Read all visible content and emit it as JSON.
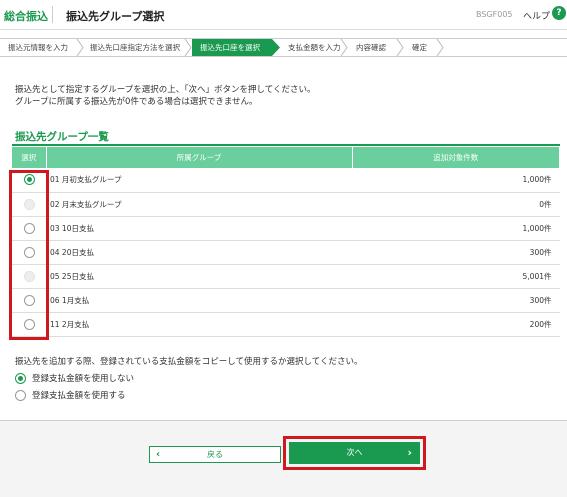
{
  "header": {
    "brand": "総合振込",
    "title": "振込先グループ選択",
    "screen_id": "BSGF005",
    "help_label": "ヘルプ",
    "help_icon": "?"
  },
  "steps": [
    {
      "label": "振込元情報を入力",
      "active": false
    },
    {
      "label": "振込先口座指定方法を選択",
      "active": false
    },
    {
      "label": "振込先口座を選択",
      "active": true
    },
    {
      "label": "支払金額を入力",
      "active": false
    },
    {
      "label": "内容確認",
      "active": false
    },
    {
      "label": "確定",
      "active": false
    }
  ],
  "intro": {
    "line1": "振込先として指定するグループを選択の上、「次へ」ボタンを押してください。",
    "line2": "グループに所属する振込先が0件である場合は選択できません。"
  },
  "section": {
    "title": "振込先グループ一覧"
  },
  "table": {
    "headers": {
      "select": "選択",
      "group": "所属グループ",
      "count": "追加対象件数"
    },
    "rows": [
      {
        "group": "01 月初支払グループ",
        "count": "1,000件",
        "state": "checked"
      },
      {
        "group": "02 月末支払グループ",
        "count": "0件",
        "state": "disabled"
      },
      {
        "group": "03 10日支払",
        "count": "1,000件",
        "state": "unchecked"
      },
      {
        "group": "04 20日支払",
        "count": "300件",
        "state": "unchecked"
      },
      {
        "group": "05 25日支払",
        "count": "5,001件",
        "state": "disabled"
      },
      {
        "group": "06 1月支払",
        "count": "300件",
        "state": "unchecked"
      },
      {
        "group": "11 2月支払",
        "count": "200件",
        "state": "unchecked"
      }
    ]
  },
  "copy": {
    "note": "振込先を追加する際、登録されている支払金額をコピーして使用するか選択してください。",
    "option_no": "登録支払金額を使用しない",
    "option_yes": "登録支払金額を使用する",
    "selected": "no"
  },
  "buttons": {
    "back": "戻る",
    "next": "次へ"
  },
  "colors": {
    "accent": "#1a9950",
    "header_row": "#6bcf9d",
    "highlight": "#d01820"
  }
}
